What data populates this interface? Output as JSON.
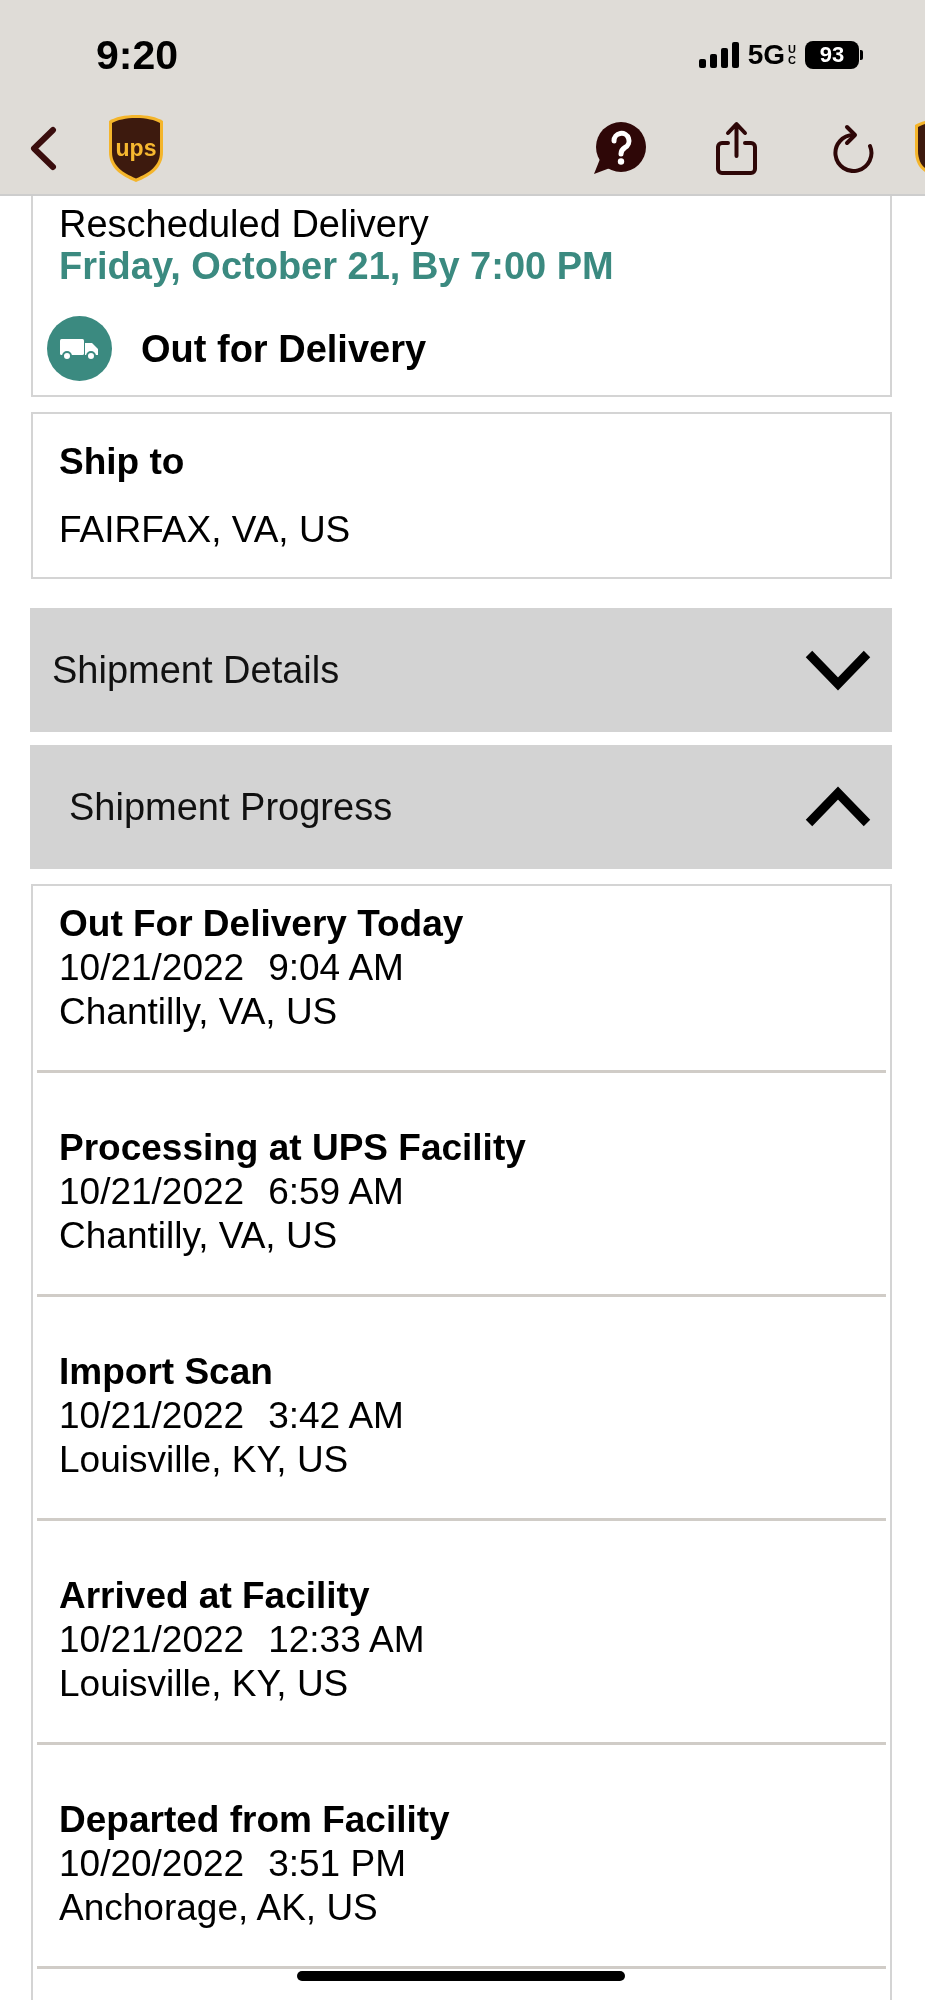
{
  "status_bar": {
    "time": "9:20",
    "network": "5G",
    "network_badge": "UC",
    "battery": "93"
  },
  "nav_bar": {
    "logo_text": "ups"
  },
  "delivery_card": {
    "label": "Rescheduled Delivery",
    "date": "Friday, October 21, By 7:00 PM",
    "status": "Out for Delivery"
  },
  "ship_to": {
    "heading": "Ship to",
    "address": "FAIRFAX, VA, US"
  },
  "sections": [
    {
      "title": "Shipment Details",
      "expanded": false
    },
    {
      "title": "Shipment Progress",
      "expanded": true
    }
  ],
  "progress_events": [
    {
      "title": "Out For Delivery Today",
      "date": "10/21/2022",
      "time": "9:04 AM",
      "location": "Chantilly, VA, US"
    },
    {
      "title": "Processing at UPS Facility",
      "date": "10/21/2022",
      "time": "6:59 AM",
      "location": "Chantilly, VA, US"
    },
    {
      "title": "Import Scan",
      "date": "10/21/2022",
      "time": "3:42 AM",
      "location": "Louisville, KY, US"
    },
    {
      "title": "Arrived at Facility",
      "date": "10/21/2022",
      "time": "12:33 AM",
      "location": "Louisville, KY, US"
    },
    {
      "title": "Departed from Facility",
      "date": "10/20/2022",
      "time": "3:51 PM",
      "location": "Anchorage, AK, US"
    }
  ]
}
